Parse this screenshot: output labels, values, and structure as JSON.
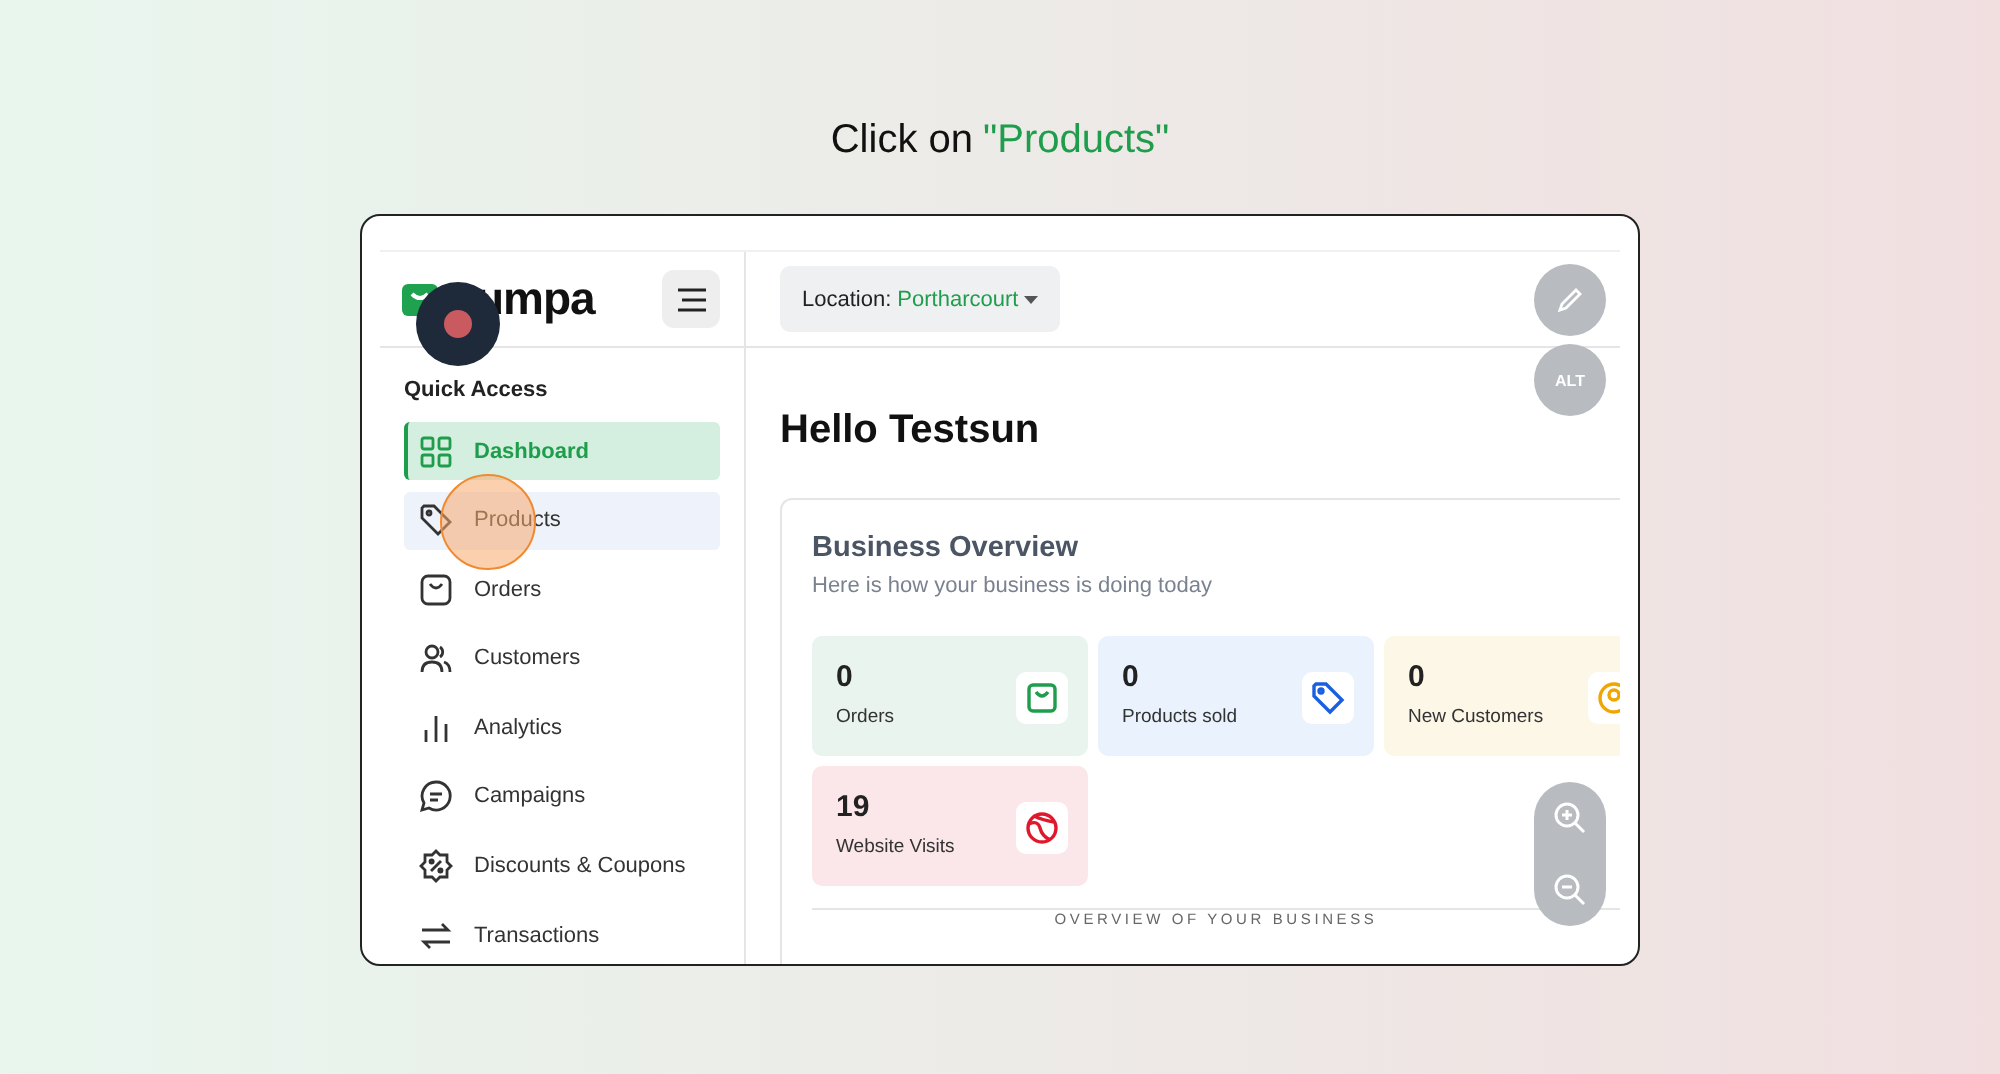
{
  "prompt": {
    "text": "Click on",
    "target": "\"Products\""
  },
  "logo": {
    "text": "umpa"
  },
  "sidebar": {
    "heading": "Quick Access",
    "items": [
      {
        "label": "Dashboard",
        "selected": true,
        "hovered": false
      },
      {
        "label": "Products",
        "selected": false,
        "hovered": true
      },
      {
        "label": "Orders",
        "selected": false,
        "hovered": false
      },
      {
        "label": "Customers",
        "selected": false,
        "hovered": false
      },
      {
        "label": "Analytics",
        "selected": false,
        "hovered": false
      },
      {
        "label": "Campaigns",
        "selected": false,
        "hovered": false
      },
      {
        "label": "Discounts & Coupons",
        "selected": false,
        "hovered": false
      },
      {
        "label": "Transactions",
        "selected": false,
        "hovered": false
      }
    ]
  },
  "location": {
    "label": "Location:",
    "value": "Portharcourt"
  },
  "greeting": "Hello Testsun",
  "overview": {
    "title": "Business Overview",
    "subtitle": "Here is how your business is doing today",
    "divider": "OVERVIEW OF YOUR BUSINESS",
    "cards": [
      {
        "value": "0",
        "label": "Orders",
        "color": "#e9f4ee"
      },
      {
        "value": "0",
        "label": "Products sold",
        "color": "#e9f2fd"
      },
      {
        "value": "0",
        "label": "New Customers",
        "color": "#fdf7e7"
      },
      {
        "value": "19",
        "label": "Website Visits",
        "color": "#fbe7ea"
      }
    ]
  },
  "float_buttons": {
    "alt": "ALT"
  }
}
